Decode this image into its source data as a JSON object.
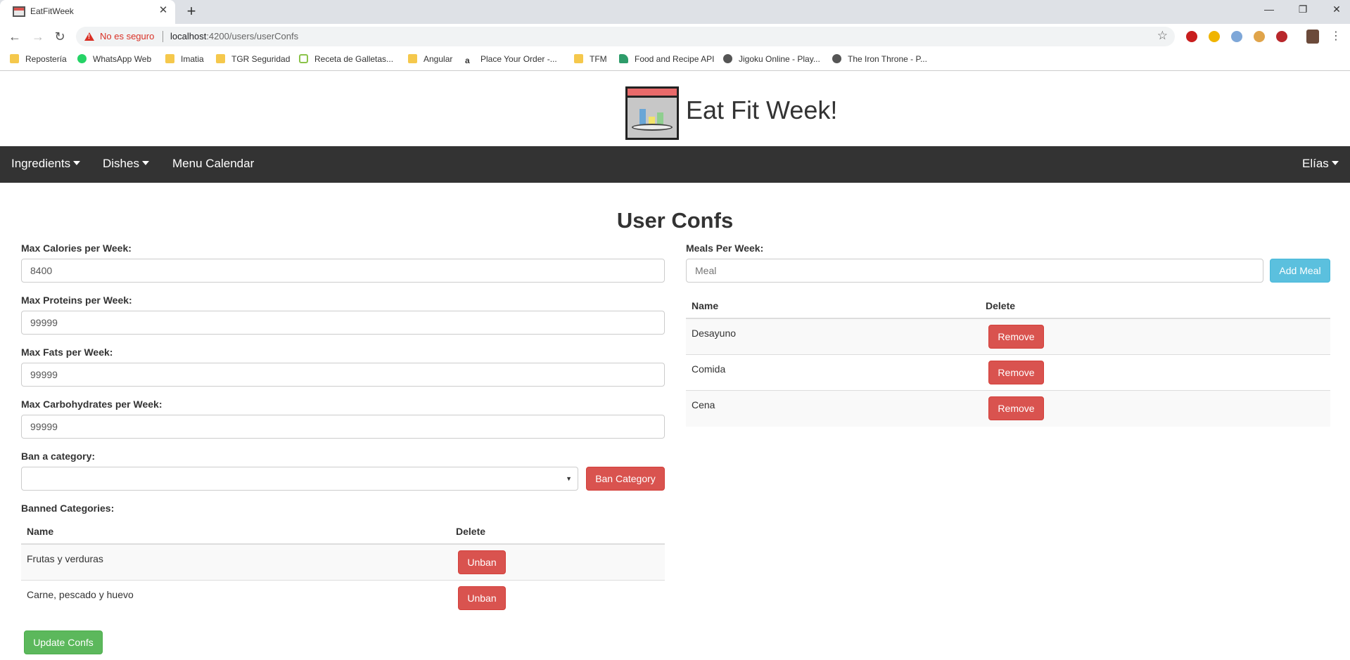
{
  "browser": {
    "tab_title": "EatFitWeek",
    "security_label": "No es seguro",
    "url_host": "localhost",
    "url_path": ":4200/users/userConfs",
    "bookmarks": [
      "Repostería",
      "WhatsApp Web",
      "Imatia",
      "TGR Seguridad",
      "Receta de Galletas...",
      "Angular",
      "Place Your Order -...",
      "TFM",
      "Food and Recipe API",
      "Jigoku Online - Play...",
      "The Iron Throne - P..."
    ]
  },
  "site": {
    "title": "Eat Fit Week!"
  },
  "navbar": {
    "ingredients": "Ingredients",
    "dishes": "Dishes",
    "menu_calendar": "Menu Calendar",
    "user": "Elías"
  },
  "page": {
    "title": "User Confs",
    "max_calories_label": "Max Calories per Week:",
    "max_calories_value": "8400",
    "max_proteins_label": "Max Proteins per Week:",
    "max_proteins_value": "99999",
    "max_fats_label": "Max Fats per Week:",
    "max_fats_value": "99999",
    "max_carbs_label": "Max Carbohydrates per Week:",
    "max_carbs_value": "99999",
    "ban_label": "Ban a category:",
    "ban_button": "Ban Category",
    "banned_label": "Banned Categories:",
    "banned_headers": {
      "name": "Name",
      "delete": "Delete"
    },
    "banned_rows": [
      {
        "name": "Frutas y verduras",
        "action": "Unban"
      },
      {
        "name": "Carne, pescado y huevo",
        "action": "Unban"
      }
    ],
    "update_button": "Update Confs",
    "meals_label": "Meals Per Week:",
    "meal_placeholder": "Meal",
    "add_meal_button": "Add Meal",
    "meals_headers": {
      "name": "Name",
      "delete": "Delete"
    },
    "meals_rows": [
      {
        "name": "Desayuno",
        "action": "Remove"
      },
      {
        "name": "Comida",
        "action": "Remove"
      },
      {
        "name": "Cena",
        "action": "Remove"
      }
    ]
  },
  "colors": {
    "navbar_bg": "#333333",
    "danger": "#d9534f",
    "info": "#5bc0de",
    "success": "#5cb85c"
  }
}
